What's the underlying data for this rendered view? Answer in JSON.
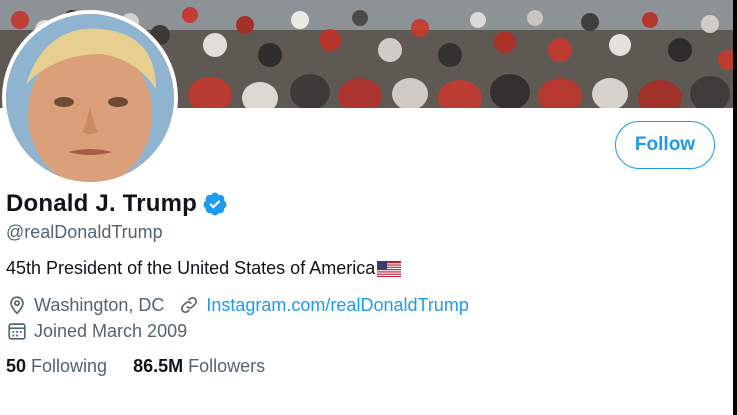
{
  "profile": {
    "display_name": "Donald J. Trump",
    "handle": "@realDonaldTrump",
    "bio": "45th President of the United States of America",
    "location": "Washington, DC",
    "website": "Instagram.com/realDonaldTrump",
    "joined": "Joined March 2009",
    "verified": true
  },
  "actions": {
    "follow_label": "Follow"
  },
  "stats": {
    "following_count": "50",
    "following_label": "Following",
    "followers_count": "86.5M",
    "followers_label": "Followers"
  },
  "icons": {
    "verified": "verified-badge-icon",
    "location": "location-pin-icon",
    "link": "link-icon",
    "calendar": "calendar-icon",
    "flag": "us-flag-icon"
  },
  "colors": {
    "accent": "#1d9bf0",
    "text_primary": "#0f1419",
    "text_secondary": "#536471"
  }
}
